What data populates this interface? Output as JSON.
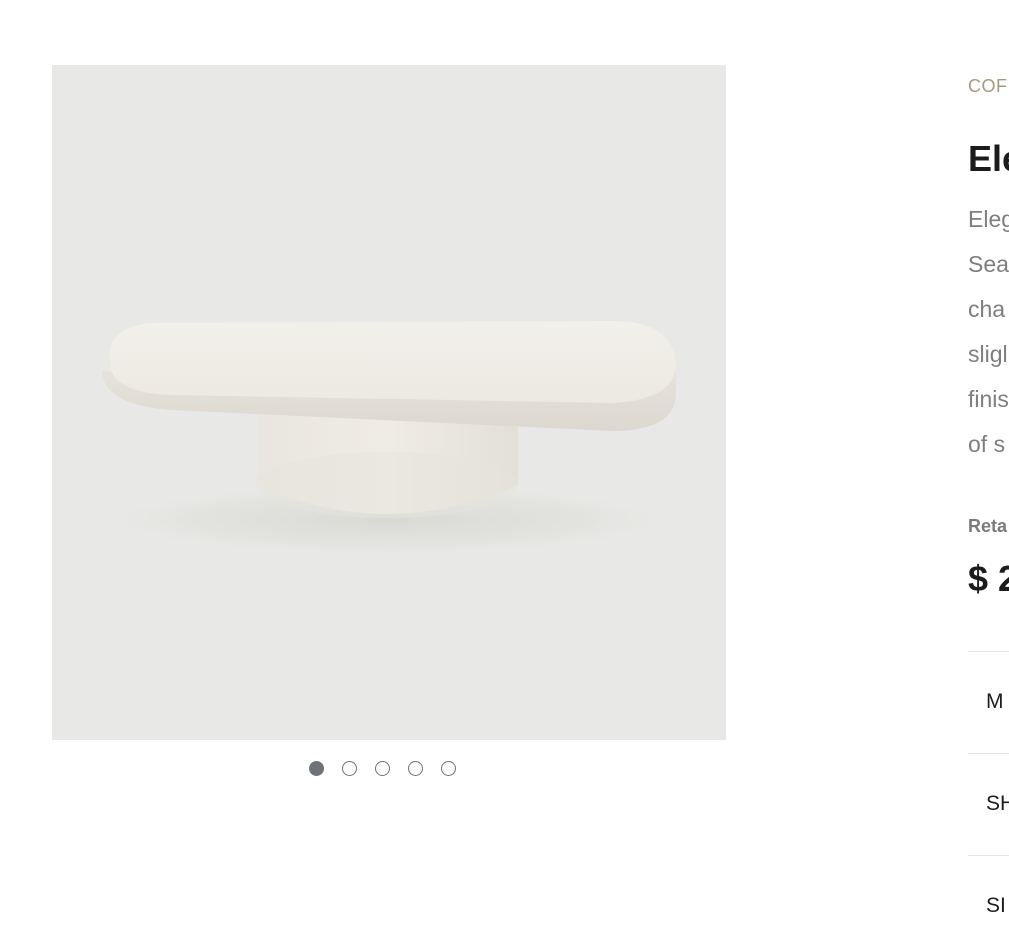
{
  "gallery": {
    "image": "product-photo-coffee-table",
    "slide_count": 5,
    "active_slide": 1,
    "colors": {
      "background": "#e8e9e6",
      "table": "#f1efe9",
      "dot_active": "#6f7377"
    }
  },
  "product": {
    "category": "COF",
    "title": "Ele",
    "description_lines": [
      "Eleg",
      "Sea",
      "cha",
      "sligl",
      "finis",
      "of s"
    ],
    "retail_label": "Reta",
    "price": "$ 2"
  },
  "accordion": {
    "items": [
      {
        "label": "M"
      },
      {
        "label": "SH"
      },
      {
        "label": "SI"
      }
    ]
  }
}
